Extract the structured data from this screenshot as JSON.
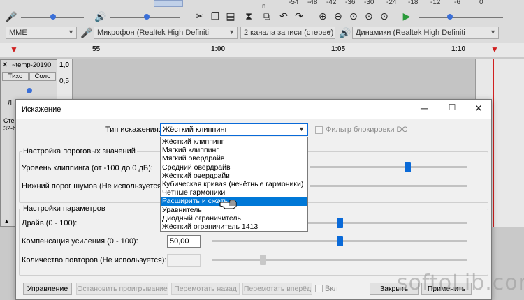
{
  "toolbar": {
    "meter_ticks": [
      "-54",
      "-48",
      "-42",
      "-36",
      "-30",
      "-24",
      "-18",
      "-12",
      "-6",
      "0"
    ],
    "meter_small": "п",
    "host_select": "MME",
    "mic_select": "Микрофон (Realtek High Definiti",
    "channels_select": "2 канала записи (стерео)",
    "speaker_select": "Динамики (Realtek High Definiti"
  },
  "timeline": {
    "labels": [
      "55",
      "1:00",
      "1:05",
      "1:10"
    ]
  },
  "track": {
    "name": "~temp-20190",
    "mute_label": "Тихо",
    "solo_label": "Соло",
    "l_label": "Л",
    "side_text_1": "Сте",
    "side_text_2": "32-б",
    "ruler_1": "1,0",
    "ruler_2": "0,5"
  },
  "dialog": {
    "title": "Искажение",
    "distortion_type_label": "Тип искажения:",
    "distortion_type_value": "Жёсткий клиппинг",
    "dc_filter_label": "Фильтр блокировки DC",
    "threshold_group_title": "Настройка пороговых значений",
    "clipping_level_label": "Уровень клиппинга (от -100 до 0 дБ):",
    "noise_floor_label": "Нижний порог шумов (Не используется):",
    "params_group_title": "Настройки параметров",
    "drive_label": "Драйв (0 - 100):",
    "gain_comp_label": "Компенсация усиления (0 - 100):",
    "gain_comp_value": "50,00",
    "repeats_label": "Количество повторов (Не используется):",
    "sliders": {
      "clipping_level": 0.62,
      "drive": 0.5,
      "gain_comp": 0.5,
      "repeats": 0.2
    },
    "options": [
      "Жёсткий клиппинг",
      "Мягкий клиппинг",
      "Мягкий овердрайв",
      "Средний овердрайв",
      "Жёсткий овердрайв",
      "Кубическая кривая (нечётные гармоники)",
      "Чётные гармоники",
      "Расширить и сжать",
      "Уравнитель",
      "Диодный ограничитель",
      "Жёсткий ограничитель 1413"
    ],
    "highlighted_option": "Расширить и сжать",
    "buttons": {
      "manage": "Управление",
      "stop": "Остановить проигрывание",
      "rewind": "Перемотать назад",
      "forward": "Перемотать вперёд",
      "enable": "Вкл",
      "close": "Закрыть",
      "apply": "Применить"
    }
  },
  "watermark": "softoLib.com",
  "colors": {
    "accent": "#0a6ad8",
    "highlight": "#0078d7",
    "dialog_bg": "#f0f0f0",
    "timeline_marker": "#d02020"
  }
}
